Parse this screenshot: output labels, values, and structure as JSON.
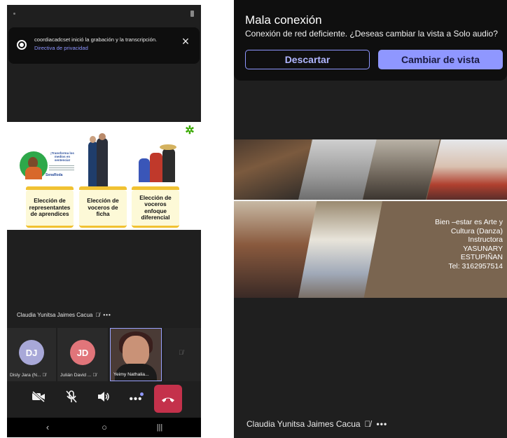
{
  "left_screen": {
    "recording_toast": {
      "message": "coordiacadcset inició la grabación y la transcripción.",
      "link": "Directiva de privacidad",
      "close_icon": "×"
    },
    "slide": {
      "mini_title": "¡Transforma los medios en sentencia!",
      "mini_brand": "SenaRoda",
      "cards": [
        "Elección de representantes de aprendices",
        "Elección de voceros de ficha",
        "Elección de voceros enfoque diferencial"
      ]
    },
    "speaker": {
      "name": "Claudia Yunitsa Jaimes Cacua",
      "more": "•••"
    },
    "participants": [
      {
        "initials": "DJ",
        "name": "Disly Jara (N...",
        "color": "#a8a8d8"
      },
      {
        "initials": "JD",
        "name": "Julián David ...",
        "color": "#e1757a"
      },
      {
        "initials": "",
        "name": "Yeimy Nathalia..."
      }
    ],
    "controls": {
      "camera_icon": "camera-off",
      "mic_icon": "mic-off",
      "speaker_icon": "speaker",
      "more": "•••",
      "hangup_icon": "phone-hangup"
    },
    "nav": {
      "back": "‹",
      "home": "○",
      "recent": "|||"
    }
  },
  "right_screen": {
    "banner": {
      "title": "Mala conexión",
      "subtitle": "Conexión de red deficiente. ¿Deseas cambiar la vista a Solo audio?",
      "dismiss_label": "Descartar",
      "switch_label": "Cambiar de vista"
    },
    "slide": {
      "text_lines": [
        "Bien –estar es Arte y",
        "Cultura (Danza)",
        "Instructora",
        "YASUNARY",
        "ESTUPIÑAN",
        "Tel: 3162957514"
      ]
    },
    "speaker": {
      "name": "Claudia Yunitsa Jaimes Cacua",
      "more": "•••"
    }
  },
  "colors": {
    "accent": "#8f97ff",
    "hangup": "#c4314b",
    "background": "#1f1f1f"
  }
}
